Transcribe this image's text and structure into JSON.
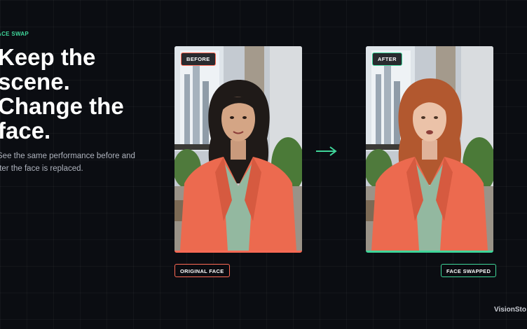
{
  "section": {
    "eyebrow": "ACE SWAP",
    "headline_lines": [
      "Keep the",
      "scene.",
      "Change the",
      "face."
    ],
    "subtitle_lines": [
      "See the same performance before and",
      "fter the face is replaced."
    ]
  },
  "comparison": {
    "before": {
      "tag": "BEFORE",
      "caption": "ORIGINAL FACE",
      "accent_color": "#ff6a55",
      "hair_color": "#1f1a18"
    },
    "after": {
      "tag": "AFTER",
      "caption": "FACE SWAPPED",
      "accent_color": "#3fd69a",
      "hair_color": "#b2582f"
    },
    "arrow_icon": "arrow-right-icon"
  },
  "watermark": "VisionSto",
  "colors": {
    "background": "#0b0d12",
    "accent_green": "#3fd69a",
    "accent_coral": "#ff6a55",
    "blazer": "#ec6a4f",
    "blouse": "#93b8a0"
  }
}
